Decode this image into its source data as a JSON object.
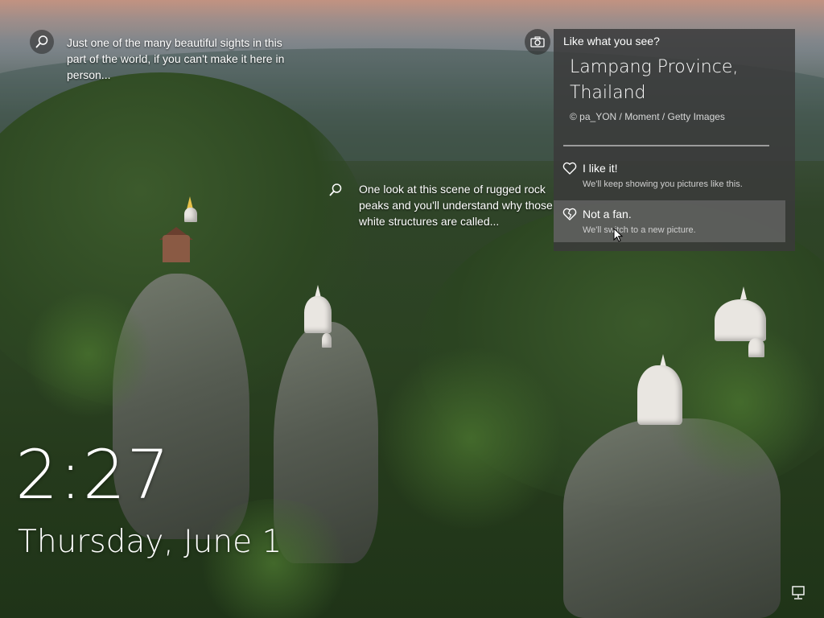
{
  "hotspots": [
    {
      "icon": "search-icon",
      "text": "Just one of the many beautiful sights in this part of the world, if you can't make it here in person..."
    },
    {
      "icon": "search-icon",
      "text": "One look at this scene of rugged rock peaks and you'll understand why those white structures are called..."
    }
  ],
  "spotlight": {
    "camera_icon": "camera-icon",
    "header": "Like what you see?",
    "location": "Lampang Province, Thailand",
    "credit": "© pa_YON / Moment / Getty Images",
    "options": [
      {
        "icon": "heart-icon",
        "label": "I like it!",
        "subtext": "We'll keep showing you pictures like this."
      },
      {
        "icon": "heart-broken-icon",
        "label": "Not a fan.",
        "subtext": "We'll switch to a new picture."
      }
    ]
  },
  "clock": {
    "time": "2:27",
    "date": "Thursday, June 1"
  },
  "status": {
    "network_icon": "network-icon"
  }
}
